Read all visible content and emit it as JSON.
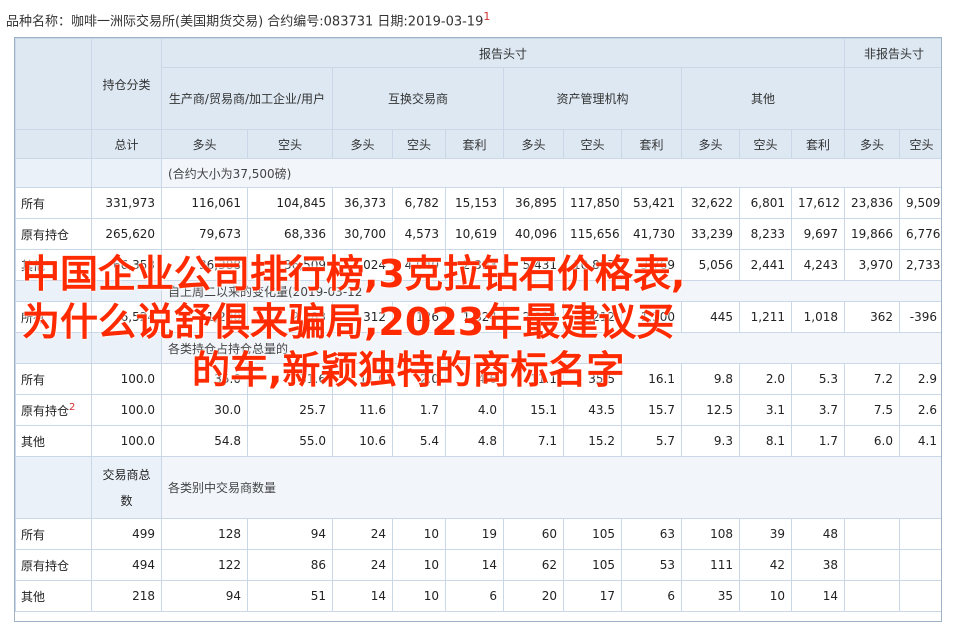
{
  "page": {
    "title": "品种名称：咖啡一洲际交易所(美国期货交易) 合约编号:083731 日期:2019-03-19",
    "title_mark": "1"
  },
  "header": {
    "position_class": "持仓分类",
    "reporting": "报告头寸",
    "non_reporting": "非报告头寸",
    "producers": "生产商/贸易商/加工企业/用户",
    "swap_dealers": "互换交易商",
    "asset_managers": "资产管理机构",
    "others": "其他",
    "total": "总计",
    "long": "多头",
    "short": "空头",
    "spread": "套利"
  },
  "sections": {
    "contract_unit": "(合约大小为37,500磅)",
    "change": "自上周二以来的变化量(2019-03-12",
    "pct": "各类持仓占持仓总量的",
    "trader_count_header": "交易商总数",
    "trader_count_note": "各类别中交易商数量"
  },
  "rows": {
    "positions": [
      {
        "label": "所有",
        "v": [
          "331,973",
          "116,061",
          "104,845",
          "36,373",
          "6,782",
          "15,153",
          "36,895",
          "117,850",
          "53,421",
          "32,622",
          "6,801",
          "17,612",
          "23,836",
          "9,509"
        ]
      },
      {
        "label": "原有持仓",
        "v": [
          "265,620",
          "79,673",
          "68,336",
          "30,700",
          "4,573",
          "10,619",
          "40,096",
          "115,656",
          "41,730",
          "33,239",
          "8,233",
          "9,697",
          "19,866",
          "6,776"
        ]
      },
      {
        "label": "其他",
        "v": [
          "66,353",
          "36,388",
          "36,509",
          "7,024",
          "4,040",
          "2,393",
          "5,431",
          "10,857",
          "3,769",
          "5,056",
          "2,441",
          "4,243",
          "3,970",
          "2,733"
        ]
      }
    ],
    "changes": [
      {
        "label": "所有",
        "v": [
          "6,524",
          "1,200",
          "2,583",
          "312",
          "126",
          "1,824",
          "2,028",
          "1,212",
          "1,300",
          "445",
          "1,211",
          "1,018",
          "362",
          "-396"
        ]
      }
    ],
    "percentages": [
      {
        "label": "所有",
        "v": [
          "100.0",
          "35.0",
          "31.6",
          "11.0",
          "2.0",
          "4.6",
          "11.1",
          "35.5",
          "16.1",
          "9.8",
          "2.0",
          "5.3",
          "7.2",
          "2.9"
        ]
      },
      {
        "label": "原有持仓",
        "mark": "2",
        "v": [
          "100.0",
          "30.0",
          "25.7",
          "11.6",
          "1.7",
          "4.0",
          "15.1",
          "43.5",
          "15.7",
          "12.5",
          "3.1",
          "3.7",
          "7.5",
          "2.6"
        ]
      },
      {
        "label": "其他",
        "v": [
          "100.0",
          "54.8",
          "55.0",
          "10.6",
          "5.4",
          "4.8",
          "7.1",
          "15.2",
          "5.7",
          "9.3",
          "8.1",
          "1.7",
          "6.0",
          "4.1"
        ]
      }
    ],
    "traders": [
      {
        "label": "所有",
        "v": [
          "499",
          "128",
          "94",
          "24",
          "10",
          "19",
          "60",
          "105",
          "63",
          "108",
          "39",
          "48",
          "",
          ""
        ]
      },
      {
        "label": "原有持仓",
        "v": [
          "494",
          "122",
          "86",
          "24",
          "10",
          "14",
          "62",
          "105",
          "53",
          "111",
          "42",
          "38",
          "",
          ""
        ]
      },
      {
        "label": "其他",
        "v": [
          "218",
          "94",
          "51",
          "14",
          "10",
          "6",
          "20",
          "17",
          "6",
          "35",
          "10",
          "14",
          "",
          ""
        ]
      }
    ]
  },
  "overlay": {
    "line1": "中国企业公司排行榜,3克拉钻石价格表,",
    "line2": "为什么说舒俱来骗局,2023年最建议买",
    "line3": "的车,新颖独特的商标名字"
  }
}
